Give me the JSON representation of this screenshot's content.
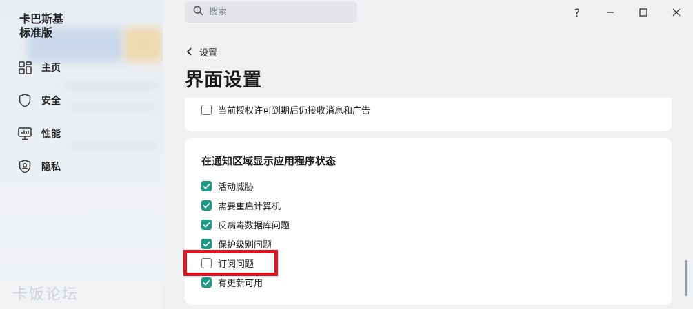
{
  "app": {
    "title_line1": "卡巴斯基",
    "title_line2": "标准版"
  },
  "sidebar": {
    "items": [
      {
        "label": "主页",
        "icon": "home-grid-icon"
      },
      {
        "label": "安全",
        "icon": "shield-icon"
      },
      {
        "label": "性能",
        "icon": "monitor-performance-icon"
      },
      {
        "label": "隐私",
        "icon": "privacy-shield-icon"
      }
    ],
    "watermark": "卡饭论坛"
  },
  "search": {
    "placeholder": "搜索"
  },
  "window_controls": {
    "help": "?",
    "minimize": "minimize-icon",
    "maximize": "maximize-icon",
    "close": "close-icon"
  },
  "breadcrumb": {
    "back_label": "设置"
  },
  "page": {
    "title": "界面设置"
  },
  "top_card": {
    "checkbox": {
      "label": "当前授权许可到期后仍接收消息和广告",
      "checked": false
    }
  },
  "notification_section": {
    "title": "在通知区域显示应用程序状态",
    "items": [
      {
        "label": "活动威胁",
        "checked": true
      },
      {
        "label": "需要重启计算机",
        "checked": true
      },
      {
        "label": "反病毒数据库问题",
        "checked": true
      },
      {
        "label": "保护级别问题",
        "checked": true
      },
      {
        "label": "订阅问题",
        "checked": false
      },
      {
        "label": "有更新可用",
        "checked": true
      }
    ]
  },
  "colors": {
    "accent_checkbox": "#1e9b87",
    "highlight": "#e0121b"
  }
}
